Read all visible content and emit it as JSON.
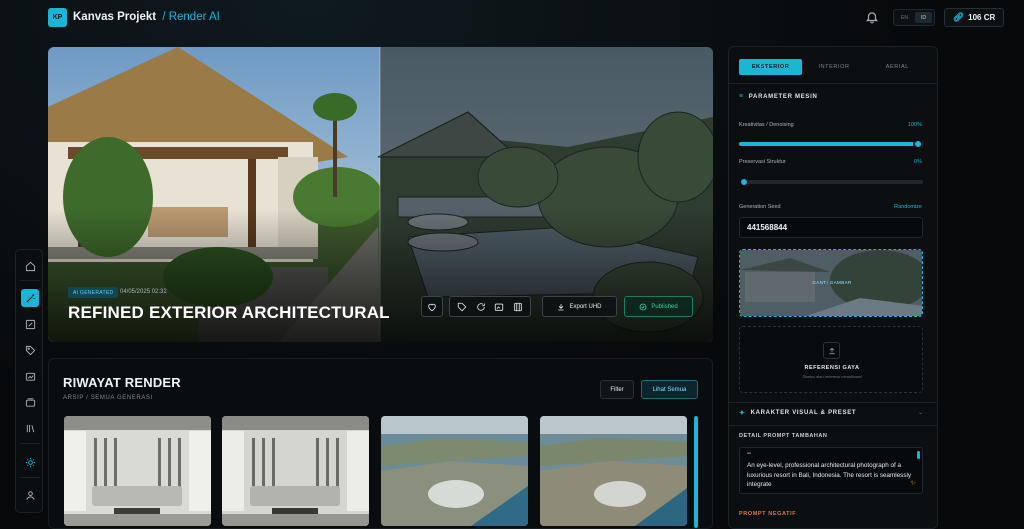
{
  "header": {
    "logo_text": "KP",
    "app_name": "Kanvas Projekt",
    "section": "/ Render AI",
    "lang_options": [
      "EN",
      "ID"
    ],
    "lang_selected": "ID",
    "credits": "106 CR"
  },
  "sidebar": {
    "items": [
      {
        "icon": "home-icon",
        "active": false
      },
      {
        "icon": "magic-wand-icon",
        "active": true
      },
      {
        "icon": "edit-icon",
        "active": false
      },
      {
        "icon": "tag-icon",
        "active": false
      },
      {
        "icon": "image-edit-icon",
        "active": false
      },
      {
        "icon": "layers-icon",
        "active": false
      },
      {
        "icon": "library-icon",
        "active": false
      },
      {
        "icon": "sun-icon",
        "active": false
      },
      {
        "icon": "user-icon",
        "active": false
      }
    ]
  },
  "hero": {
    "badge": "AI GENERATED",
    "date": "04/05/2025 02:32",
    "title": "REFINED EXTERIOR ARCHITECTURAL",
    "export_label": "Export UHD",
    "published_label": "Published"
  },
  "history": {
    "title": "RIWAYAT RENDER",
    "subtitle": "ARSIP / SEMUA GENERASI",
    "filter_label": "Filter",
    "see_all_label": "Lihat Semua",
    "thumbnails": [
      {
        "kind": "interior-living-room"
      },
      {
        "kind": "interior-living-room"
      },
      {
        "kind": "aerial-coast-resort"
      },
      {
        "kind": "aerial-coast-resort"
      }
    ]
  },
  "panel": {
    "tabs": [
      "EKSTERIOR",
      "INTERIOR",
      "AERIAL"
    ],
    "active_tab": "EKSTERIOR",
    "engine_heading": "PARAMETER MESIN",
    "creativity": {
      "label": "Kreativitas / Denoising",
      "value_text": "100%",
      "value": 1.0
    },
    "structure": {
      "label": "Preservasi Struktur",
      "value_text": "0%",
      "value": 0.0
    },
    "seed": {
      "label": "Generation Seed",
      "action": "Randomize",
      "value": "441568844"
    },
    "replace_image_label": "GANTI GAMBAR",
    "style_ref": {
      "title": "REFERENSI GAYA",
      "hint": "Sketsa atau referensi moodboard"
    },
    "visual_heading": "KARAKTER VISUAL & PRESET",
    "prompt_label": "DETAIL PROMPT TAMBAHAN",
    "prompt_quote": "\"\"",
    "prompt_text": "An eye-level, professional architectural photograph of a luxurious resort in Bali, Indonesia. The resort is seamlessly integrate",
    "negative_label": "PROMPT NEGATIF"
  },
  "colors": {
    "accent": "#1bb6d6",
    "published": "#39d39d",
    "negative": "#e0744a",
    "background": "#07090b"
  }
}
